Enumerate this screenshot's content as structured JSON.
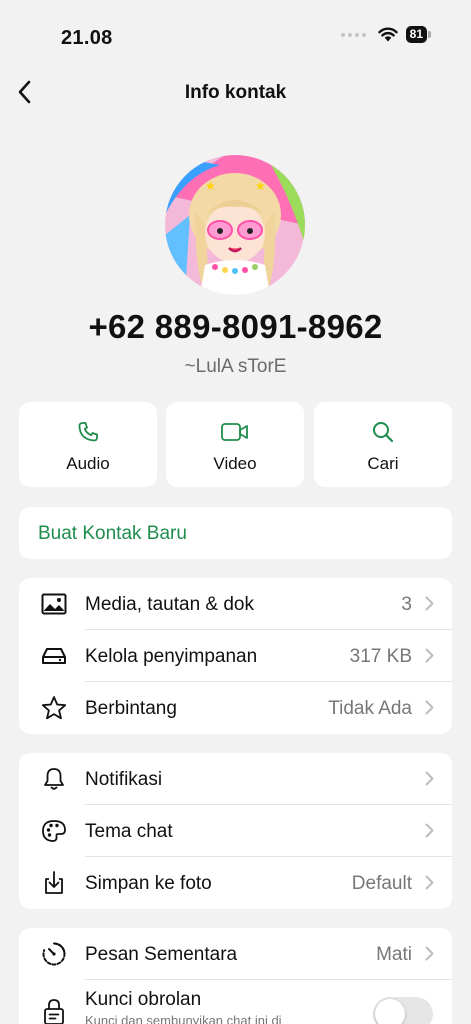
{
  "status_bar": {
    "time": "21.08",
    "battery": "81"
  },
  "nav": {
    "title": "Info kontak",
    "back_icon": "chevron-left-icon"
  },
  "contact": {
    "phone": "+62 889-8091-8962",
    "pushname": "~LulA sTorE"
  },
  "actions": [
    {
      "label": "Audio",
      "icon": "phone-icon"
    },
    {
      "label": "Video",
      "icon": "video-icon"
    },
    {
      "label": "Cari",
      "icon": "search-icon"
    }
  ],
  "new_contact": {
    "label": "Buat Kontak Baru"
  },
  "section1": [
    {
      "label": "Media, tautan & dok",
      "value": "3",
      "icon": "image-icon"
    },
    {
      "label": "Kelola penyimpanan",
      "value": "317 KB",
      "icon": "storage-icon"
    },
    {
      "label": "Berbintang",
      "value": "Tidak Ada",
      "icon": "star-icon"
    }
  ],
  "section2": [
    {
      "label": "Notifikasi",
      "value": "",
      "icon": "bell-icon"
    },
    {
      "label": "Tema chat",
      "value": "",
      "icon": "palette-icon"
    },
    {
      "label": "Simpan ke foto",
      "value": "Default",
      "icon": "download-icon"
    }
  ],
  "section3": [
    {
      "label": "Pesan Sementara",
      "value": "Mati",
      "icon": "timer-icon"
    },
    {
      "label": "Kunci obrolan",
      "sublabel": "Kunci dan sembunyikan chat ini di",
      "icon": "lock-chat-icon",
      "toggle": false
    }
  ],
  "colors": {
    "accent": "#1f8d4e",
    "background": "#f2f2f2",
    "card": "#ffffff"
  }
}
